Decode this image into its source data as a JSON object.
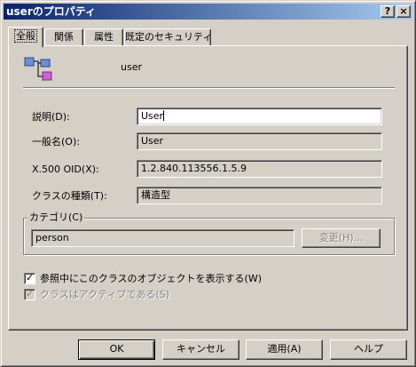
{
  "window": {
    "title": "userのプロパティ",
    "help_button": "?",
    "close_button": "×"
  },
  "tabs": [
    {
      "label": "全般",
      "active": true
    },
    {
      "label": "関係",
      "active": false
    },
    {
      "label": "属性",
      "active": false
    },
    {
      "label": "既定のセキュリティ",
      "active": false
    }
  ],
  "general": {
    "object_icon": "class-object-icon",
    "object_name": "user",
    "fields": [
      {
        "label": "説明(D):",
        "value": "User",
        "editable": true
      },
      {
        "label": "一般名(O):",
        "value": "User",
        "editable": false
      },
      {
        "label": "X.500 OID(X):",
        "value": "1.2.840.113556.1.5.9",
        "editable": false
      },
      {
        "label": "クラスの種類(T):",
        "value": "構造型",
        "editable": false
      }
    ],
    "category": {
      "group_label": "カテゴリ(C)",
      "value": "person",
      "change_button": "変更(H)..."
    },
    "checkboxes": [
      {
        "label": "参照中にこのクラスのオブジェクトを表示する(W)",
        "checked": true,
        "enabled": true
      },
      {
        "label": "クラスはアクティブである(S)",
        "checked": true,
        "enabled": false
      }
    ]
  },
  "footer": {
    "ok": "OK",
    "cancel": "キャンセル",
    "apply": "適用(A)",
    "help": "ヘルプ"
  },
  "colors": {
    "title_gradient_start": "#0a246a",
    "title_gradient_end": "#a6caf0",
    "face": "#d4d0c8"
  }
}
